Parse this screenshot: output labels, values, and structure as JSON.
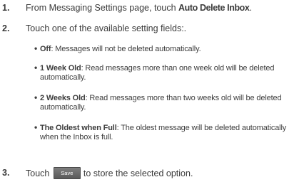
{
  "steps": [
    {
      "num": "1.",
      "text_before": "From Messaging Settings page, touch ",
      "bold": "Auto Delete Inbox",
      "text_after": "."
    },
    {
      "num": "2.",
      "text": "Touch one of the available setting fields:."
    },
    {
      "num": "3.",
      "text_before": "Touch",
      "button_label": "Save",
      "text_after": "to store the selected option."
    }
  ],
  "options": [
    {
      "bold": "Off",
      "desc": ": Messages will not be deleted automatically."
    },
    {
      "bold": "1 Week Old",
      "desc": ": Read messages more than one week old will be deleted automatically."
    },
    {
      "bold": "2 Weeks Old",
      "desc": ": Read messages more than two weeks old will be deleted automatically."
    },
    {
      "bold": "The Oldest when Full",
      "desc": ": The oldest message will be deleted automatically when the Inbox is full."
    }
  ]
}
